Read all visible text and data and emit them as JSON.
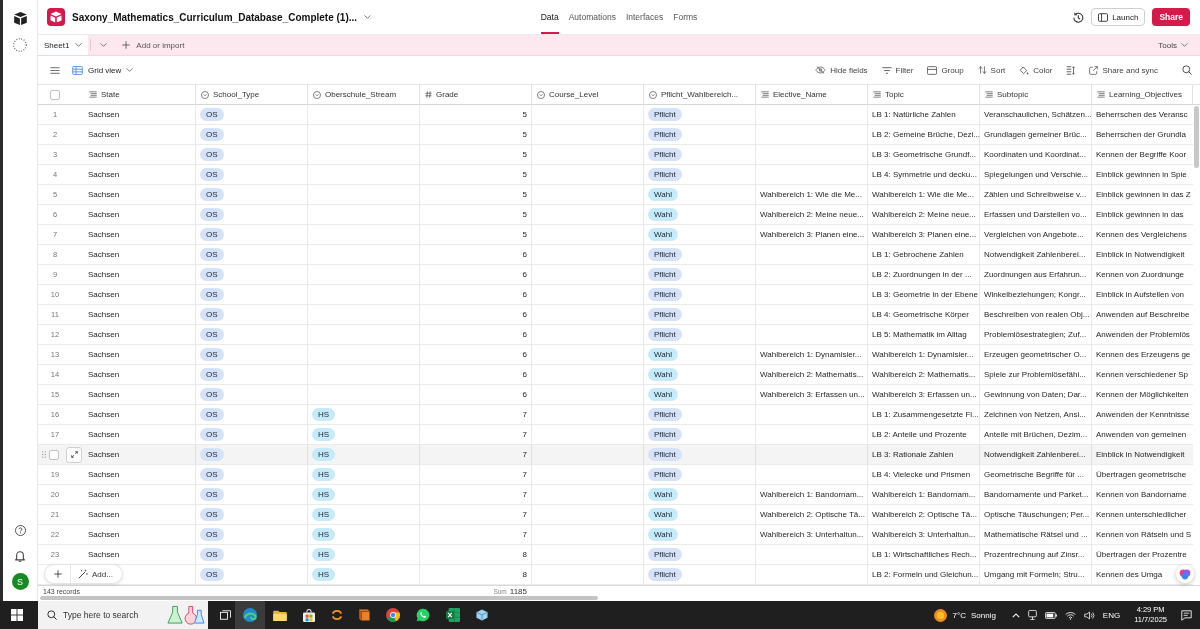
{
  "rail": {
    "avatar": "S"
  },
  "topbar": {
    "title": "Saxony_Mathematics_Curriculum_Database_Complete (1)...",
    "nav": [
      {
        "label": "Data",
        "selected": true
      },
      {
        "label": "Automations",
        "selected": false
      },
      {
        "label": "Interfaces",
        "selected": false
      },
      {
        "label": "Forms",
        "selected": false
      }
    ],
    "buttons": [
      {
        "label": "Launch",
        "kind": "outline"
      },
      {
        "label": "Share",
        "kind": "primary"
      }
    ]
  },
  "sheet_bar": {
    "tabs": [
      {
        "label": "Sheet1",
        "selected": true
      }
    ],
    "add": "Add or import",
    "tools": "Tools"
  },
  "toolbar": {
    "view": "Grid view",
    "actions": [
      {
        "kind": "hide",
        "label": "Hide fields"
      },
      {
        "kind": "filter",
        "label": "Filter"
      },
      {
        "kind": "group",
        "label": "Group"
      },
      {
        "kind": "sort",
        "label": "Sort"
      },
      {
        "kind": "color",
        "label": "Color"
      },
      {
        "kind": "row_height"
      },
      {
        "kind": "share",
        "label": "Share and sync"
      },
      {
        "kind": "search"
      }
    ]
  },
  "table": {
    "header_checkbox": {
      "checked": false
    },
    "columns": [
      {
        "name": "State",
        "kind": "long_text"
      },
      {
        "name": "School_Type",
        "kind": "single_select"
      },
      {
        "name": "Oberschule_Stream",
        "kind": "single_select"
      },
      {
        "name": "Grade",
        "kind": "number"
      },
      {
        "name": "Course_Level",
        "kind": "single_select"
      },
      {
        "name": "Pflicht_Wahlbereich...",
        "kind": "single_select"
      },
      {
        "name": "Elective_Name",
        "kind": "long_text"
      },
      {
        "name": "Topic",
        "kind": "long_text"
      },
      {
        "name": "Subtopic",
        "kind": "long_text"
      },
      {
        "name": "Learning_Objectives",
        "kind": "long_text"
      }
    ],
    "rows": [
      {
        "number": "1",
        "hovered": false,
        "checked": false,
        "cells": [
          "Sachsen",
          {
            "text": "OS",
            "color": "#d4e2fa"
          },
          null,
          "5",
          null,
          {
            "text": "Pflicht",
            "color": "#d4e2fa"
          },
          null,
          "LB 1: Natürliche Zahlen",
          "Veranschaulichen, Schätzen...",
          "Beherrschen des Veransc"
        ]
      },
      {
        "number": "2",
        "hovered": false,
        "checked": false,
        "cells": [
          "Sachsen",
          {
            "text": "OS",
            "color": "#d4e2fa"
          },
          null,
          "5",
          null,
          {
            "text": "Pflicht",
            "color": "#d4e2fa"
          },
          null,
          "LB 2: Gemeine Brüche, Dezi...",
          "Grundlagen gemeiner Brüc...",
          "Beherrschen der Grundla"
        ]
      },
      {
        "number": "3",
        "hovered": false,
        "checked": false,
        "cells": [
          "Sachsen",
          {
            "text": "OS",
            "color": "#d4e2fa"
          },
          null,
          "5",
          null,
          {
            "text": "Pflicht",
            "color": "#d4e2fa"
          },
          null,
          "LB 3: Geometrische Grundf...",
          "Koordinaten und Koordinat...",
          "Kennen der Begriffe Koor"
        ]
      },
      {
        "number": "4",
        "hovered": false,
        "checked": false,
        "cells": [
          "Sachsen",
          {
            "text": "OS",
            "color": "#d4e2fa"
          },
          null,
          "5",
          null,
          {
            "text": "Pflicht",
            "color": "#d4e2fa"
          },
          null,
          "LB 4: Symmetrie und decku...",
          "Spiegelungen und Verschie...",
          "Einblick gewinnen in Spie"
        ]
      },
      {
        "number": "5",
        "hovered": false,
        "checked": false,
        "cells": [
          "Sachsen",
          {
            "text": "OS",
            "color": "#d4e2fa"
          },
          null,
          "5",
          null,
          {
            "text": "Wahl",
            "color": "#c5eafa"
          },
          "Wahlbereich 1: Wie die Me...",
          "Wahlbereich 1: Wie die Me...",
          "Zählen und Schreibweise v...",
          "Einblick gewinnen in das Z"
        ]
      },
      {
        "number": "6",
        "hovered": false,
        "checked": false,
        "cells": [
          "Sachsen",
          {
            "text": "OS",
            "color": "#d4e2fa"
          },
          null,
          "5",
          null,
          {
            "text": "Wahl",
            "color": "#c5eafa"
          },
          "Wahlbereich 2: Meine neue...",
          "Wahlbereich 2: Meine neue...",
          "Erfassen und Darstellen vo...",
          "Einblick gewinnen in das"
        ]
      },
      {
        "number": "7",
        "hovered": false,
        "checked": false,
        "cells": [
          "Sachsen",
          {
            "text": "OS",
            "color": "#d4e2fa"
          },
          null,
          "5",
          null,
          {
            "text": "Wahl",
            "color": "#c5eafa"
          },
          "Wahlbereich 3: Planen eine...",
          "Wahlbereich 3: Planen eine...",
          "Vergleichen von Angebote...",
          "Kennen des Vergleichens"
        ]
      },
      {
        "number": "8",
        "hovered": false,
        "checked": false,
        "cells": [
          "Sachsen",
          {
            "text": "OS",
            "color": "#d4e2fa"
          },
          null,
          "6",
          null,
          {
            "text": "Pflicht",
            "color": "#d4e2fa"
          },
          null,
          "LB 1: Gebrochene Zahlen",
          "Notwendigkeit Zahlenberei...",
          "Einblick in Notwendigkeit"
        ]
      },
      {
        "number": "9",
        "hovered": false,
        "checked": false,
        "cells": [
          "Sachsen",
          {
            "text": "OS",
            "color": "#d4e2fa"
          },
          null,
          "6",
          null,
          {
            "text": "Pflicht",
            "color": "#d4e2fa"
          },
          null,
          "LB 2: Zuordnungen in der ...",
          "Zuordnungen aus Erfahrun...",
          "Kennen von Zuordnunge"
        ]
      },
      {
        "number": "10",
        "hovered": false,
        "checked": false,
        "cells": [
          "Sachsen",
          {
            "text": "OS",
            "color": "#d4e2fa"
          },
          null,
          "6",
          null,
          {
            "text": "Pflicht",
            "color": "#d4e2fa"
          },
          null,
          "LB 3: Geometrie in der Ebene",
          "Winkelbeziehungen; Kongr...",
          "Einblick in Aufstellen von"
        ]
      },
      {
        "number": "11",
        "hovered": false,
        "checked": false,
        "cells": [
          "Sachsen",
          {
            "text": "OS",
            "color": "#d4e2fa"
          },
          null,
          "6",
          null,
          {
            "text": "Pflicht",
            "color": "#d4e2fa"
          },
          null,
          "LB 4: Geometrische Körper",
          "Beschreiben von realen Obj...",
          "Anwenden auf Beschreibe"
        ]
      },
      {
        "number": "12",
        "hovered": false,
        "checked": false,
        "cells": [
          "Sachsen",
          {
            "text": "OS",
            "color": "#d4e2fa"
          },
          null,
          "6",
          null,
          {
            "text": "Pflicht",
            "color": "#d4e2fa"
          },
          null,
          "LB 5: Mathematik im Alltag",
          "Problemlösestrategien; Zuf...",
          "Anwenden der Problemlös"
        ]
      },
      {
        "number": "13",
        "hovered": false,
        "checked": false,
        "cells": [
          "Sachsen",
          {
            "text": "OS",
            "color": "#d4e2fa"
          },
          null,
          "6",
          null,
          {
            "text": "Wahl",
            "color": "#c5eafa"
          },
          "Wahlbereich 1: Dynamisier...",
          "Wahlbereich 1: Dynamisier...",
          "Erzeugen geometrischer O...",
          "Kennen des Erzeugens ge"
        ]
      },
      {
        "number": "14",
        "hovered": false,
        "checked": false,
        "cells": [
          "Sachsen",
          {
            "text": "OS",
            "color": "#d4e2fa"
          },
          null,
          "6",
          null,
          {
            "text": "Wahl",
            "color": "#c5eafa"
          },
          "Wahlbereich 2: Mathematis...",
          "Wahlbereich 2: Mathematis...",
          "Spiele zur Problemlösefähi...",
          "Kennen verschiedener Sp"
        ]
      },
      {
        "number": "15",
        "hovered": false,
        "checked": false,
        "cells": [
          "Sachsen",
          {
            "text": "OS",
            "color": "#d4e2fa"
          },
          null,
          "6",
          null,
          {
            "text": "Wahl",
            "color": "#c5eafa"
          },
          "Wahlbereich 3: Erfassen un...",
          "Wahlbereich 3: Erfassen un...",
          "Gewinnung von Daten; Dar...",
          "Kennen der Möglichkeiten"
        ]
      },
      {
        "number": "16",
        "hovered": false,
        "checked": false,
        "cells": [
          "Sachsen",
          {
            "text": "OS",
            "color": "#d4e2fa"
          },
          {
            "text": "HS",
            "color": "#c5eafa"
          },
          "7",
          null,
          {
            "text": "Pflicht",
            "color": "#d4e2fa"
          },
          null,
          "LB 1: Zusammengesetzte Fl...",
          "Zeichnen von Netzen, Ansi...",
          "Anwenden der Kenntnisse"
        ]
      },
      {
        "number": "17",
        "hovered": false,
        "checked": false,
        "cells": [
          "Sachsen",
          {
            "text": "OS",
            "color": "#d4e2fa"
          },
          {
            "text": "HS",
            "color": "#c5eafa"
          },
          "7",
          null,
          {
            "text": "Pflicht",
            "color": "#d4e2fa"
          },
          null,
          "LB 2: Anteile und Prozente",
          "Anteile mit Brüchen, Dezim...",
          "Anwenden von gemeinen"
        ]
      },
      {
        "hovered": true,
        "checked": false,
        "cells": [
          "Sachsen",
          {
            "text": "OS",
            "color": "#d4e2fa"
          },
          {
            "text": "HS",
            "color": "#c5eafa"
          },
          "7",
          null,
          {
            "text": "Pflicht",
            "color": "#d4e2fa"
          },
          null,
          "LB 3: Rationale Zahlen",
          "Notwendigkeit Zahlenberei...",
          "Einblick in Notwendigkeit"
        ]
      },
      {
        "number": "19",
        "hovered": false,
        "checked": false,
        "cells": [
          "Sachsen",
          {
            "text": "OS",
            "color": "#d4e2fa"
          },
          {
            "text": "HS",
            "color": "#c5eafa"
          },
          "7",
          null,
          {
            "text": "Pflicht",
            "color": "#d4e2fa"
          },
          null,
          "LB 4: Vielecke und Prismen",
          "Geometrische Begriffe für ...",
          "Übertragen geometrische"
        ]
      },
      {
        "number": "20",
        "hovered": false,
        "checked": false,
        "cells": [
          "Sachsen",
          {
            "text": "OS",
            "color": "#d4e2fa"
          },
          {
            "text": "HS",
            "color": "#c5eafa"
          },
          "7",
          null,
          {
            "text": "Wahl",
            "color": "#c5eafa"
          },
          "Wahlbereich 1: Bandornam...",
          "Wahlbereich 1: Bandornam...",
          "Bandornamente und Parket...",
          "Kennen von Bandorname"
        ]
      },
      {
        "number": "21",
        "hovered": false,
        "checked": false,
        "cells": [
          "Sachsen",
          {
            "text": "OS",
            "color": "#d4e2fa"
          },
          {
            "text": "HS",
            "color": "#c5eafa"
          },
          "7",
          null,
          {
            "text": "Wahl",
            "color": "#c5eafa"
          },
          "Wahlbereich 2: Optische Tä...",
          "Wahlbereich 2: Optische Tä...",
          "Optische Täuschungen; Per...",
          "Kennen unterschiedlicher"
        ]
      },
      {
        "number": "22",
        "hovered": false,
        "checked": false,
        "cells": [
          "Sachsen",
          {
            "text": "OS",
            "color": "#d4e2fa"
          },
          {
            "text": "HS",
            "color": "#c5eafa"
          },
          "7",
          null,
          {
            "text": "Wahl",
            "color": "#c5eafa"
          },
          "Wahlbereich 3: Unterhaltun...",
          "Wahlbereich 3: Unterhaltun...",
          "Mathematische Rätsel und ...",
          "Kennen von Rätseln und S"
        ]
      },
      {
        "number": "23",
        "hovered": false,
        "checked": false,
        "cells": [
          "Sachsen",
          {
            "text": "OS",
            "color": "#d4e2fa"
          },
          {
            "text": "HS",
            "color": "#c5eafa"
          },
          "8",
          null,
          {
            "text": "Pflicht",
            "color": "#d4e2fa"
          },
          null,
          "LB 1: Wirtschaftliches Rech...",
          "Prozentrechnung auf Zinsr...",
          "Übertragen der Prozentre"
        ]
      },
      {
        "hovered": false,
        "checked": false,
        "cells": [
          null,
          {
            "text": "OS",
            "color": "#d4e2fa"
          },
          {
            "text": "HS",
            "color": "#c5eafa"
          },
          "8",
          null,
          {
            "text": "Pflicht",
            "color": "#d4e2fa"
          },
          null,
          "LB 2: Formeln und Gleichun...",
          "Umgang mit Formeln; Stru...",
          "Kennen des Umga"
        ]
      }
    ]
  },
  "footer": {
    "records": "143 records",
    "sum_label": "Sum",
    "sum": "1185"
  },
  "add_bar": {
    "label": "Add..."
  },
  "taskbar": {
    "search_placeholder": "Type here to search",
    "apps": [
      {
        "kind": "browser",
        "selected": true
      },
      {
        "kind": "folder",
        "selected": false
      },
      {
        "kind": "store",
        "selected": false
      },
      {
        "kind": "arrows",
        "selected": false
      },
      {
        "kind": "book",
        "selected": false
      },
      {
        "kind": "circle",
        "selected": false
      },
      {
        "kind": "chat",
        "selected": false
      },
      {
        "kind": "sheet",
        "selected": false
      },
      {
        "kind": "cube",
        "selected": false
      }
    ],
    "weather": {
      "temperature": "7°C",
      "condition": "Sonnig"
    },
    "language": "ENG",
    "time": "4:29 PM",
    "date": "11/7/2025"
  }
}
